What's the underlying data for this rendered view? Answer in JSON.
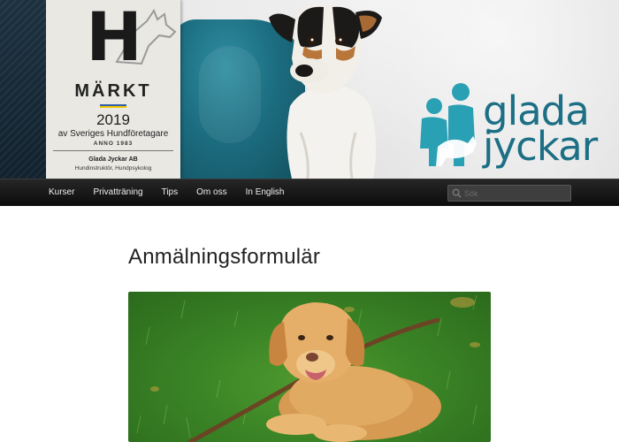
{
  "header": {
    "badge": {
      "letter": "H",
      "mark": "MÄRKT",
      "year": "2019",
      "issuer": "av Sveriges Hundföretagare",
      "anno": "ANNO 1983",
      "company": "Glada Jyckar AB",
      "roles": "Hundinstruktör, Hundpsykolog"
    },
    "logo": {
      "line1": "glada",
      "line2": "jyckar",
      "color": "#1c6f85"
    }
  },
  "nav": {
    "items": [
      {
        "label": "Kurser"
      },
      {
        "label": "Privatträning"
      },
      {
        "label": "Tips"
      },
      {
        "label": "Om oss"
      },
      {
        "label": "In English"
      }
    ],
    "search": {
      "placeholder": "Sök"
    }
  },
  "main": {
    "title": "Anmälningsformulär"
  },
  "colors": {
    "nav_background": "#111111",
    "accent_teal": "#2aa0b4",
    "logo_text": "#1c6f85"
  },
  "icons": [
    "search-icon",
    "dog-silhouette-icon",
    "family-dog-logo-icon"
  ]
}
